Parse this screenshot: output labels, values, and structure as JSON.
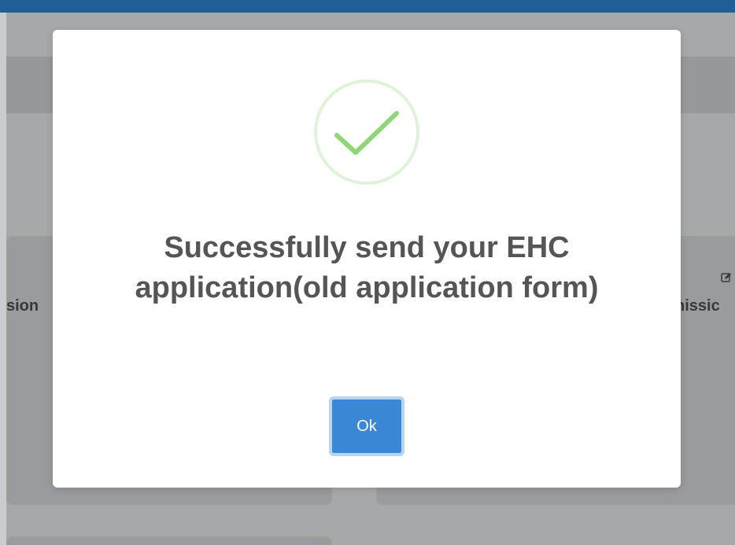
{
  "background": {
    "left_card_text": "sion",
    "right_card_text": "nissic",
    "edit_icon": "edit-icon"
  },
  "modal": {
    "icon": "checkmark-circle-icon",
    "message": "Successfully send your EHC application(old application form)",
    "ok_label": "Ok"
  },
  "colors": {
    "top_bar": "#1f5f96",
    "success_green": "#8fd677",
    "button_blue": "#3a87d6",
    "message_text": "#555555"
  }
}
